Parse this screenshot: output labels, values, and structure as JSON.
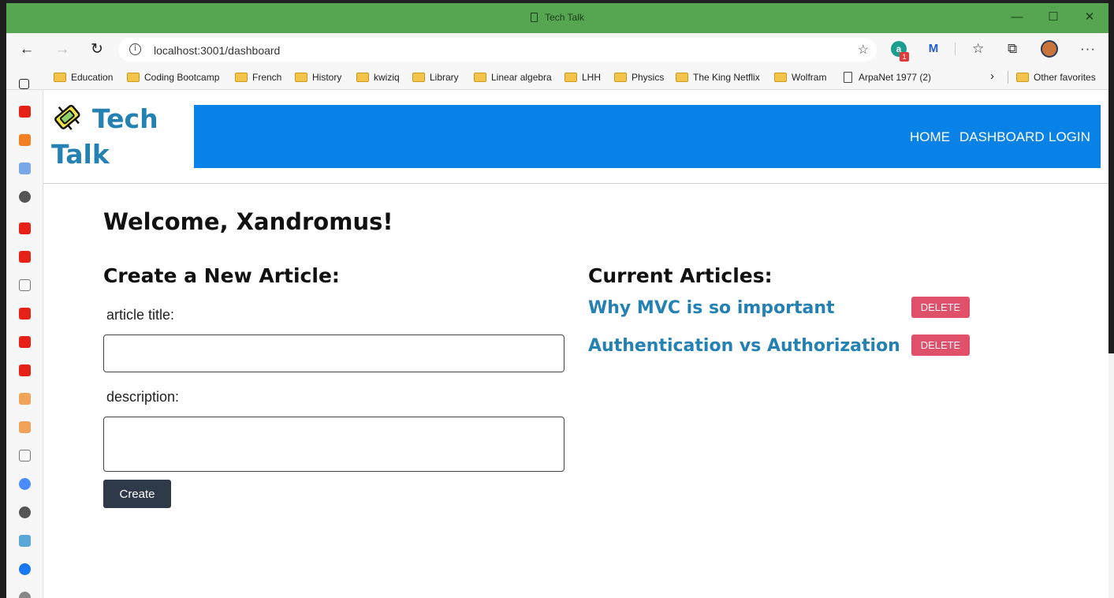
{
  "browser": {
    "window_title": "Tech Talk",
    "url": "localhost:3001/dashboard",
    "extension_badge": "1",
    "bookmarks": [
      "Education",
      "Coding Bootcamp",
      "French",
      "History",
      "kwiziq",
      "Library",
      "Linear algebra",
      "LHH",
      "Physics",
      "The King Netflix",
      "Wolfram",
      "ArpaNet 1977 (2)"
    ],
    "other_favorites": "Other favorites",
    "theme_color": "#55a551"
  },
  "site": {
    "brand_line1": "Tech",
    "brand_line2": "Talk",
    "nav": [
      "HOME",
      "DASHBOARD",
      "LOGIN"
    ],
    "navbar_color": "#0882e6",
    "brand_color": "#2481b4"
  },
  "dashboard": {
    "welcome": "Welcome, Xandromus!",
    "create_heading": "Create a New Article:",
    "title_label": "article title:",
    "title_value": "",
    "description_label": "description:",
    "description_value": "",
    "create_button": "Create",
    "current_heading": "Current Articles:",
    "articles": [
      {
        "title": "Why MVC is so important",
        "delete_label": "DELETE"
      },
      {
        "title": "Authentication vs Authorization",
        "delete_label": "DELETE"
      }
    ],
    "delete_color": "#e0506a"
  }
}
